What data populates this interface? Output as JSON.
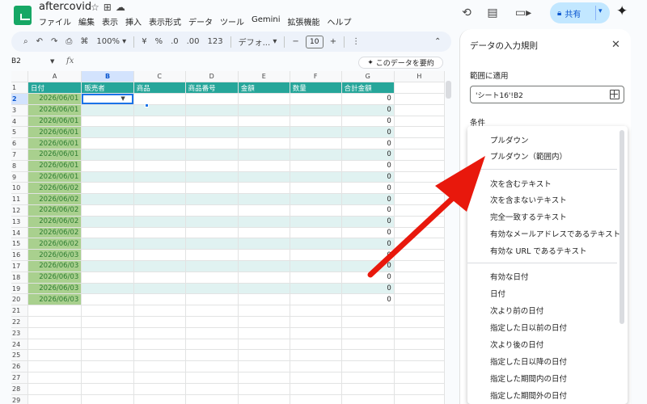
{
  "header": {
    "doc_title": "aftercovid",
    "title_icons": [
      "star-icon",
      "folder-move-icon",
      "cloud-saved-icon"
    ],
    "menu": [
      "ファイル",
      "編集",
      "表示",
      "挿入",
      "表示形式",
      "データ",
      "ツール",
      "Gemini",
      "拡張機能",
      "ヘルプ"
    ],
    "share_label": "共有",
    "right_icons": [
      "history-icon",
      "comment-icon",
      "meet-icon",
      "gemini-spark-icon"
    ]
  },
  "toolbar": {
    "zoom": "100%",
    "currency": "¥",
    "percent": "%",
    "dec_decrease": ".0",
    "dec_increase": ".00",
    "number_format": "123",
    "font": "デフォ...",
    "font_minus": "−",
    "font_size": "10",
    "font_plus": "+",
    "more": "⋮",
    "collapse": "⌃"
  },
  "formula_bar": {
    "name_box": "B2",
    "fx": "fx",
    "summarize_label": "このデータを要約"
  },
  "grid": {
    "col_letters": [
      "A",
      "B",
      "C",
      "D",
      "E",
      "F",
      "G",
      "H"
    ],
    "selected_col": "B",
    "header_row": [
      "日付",
      "販売者",
      "商品",
      "商品番号",
      "金額",
      "数量",
      "合計金額",
      ""
    ],
    "dates": [
      "2026/06/01",
      "2026/06/01",
      "2026/06/01",
      "2026/06/01",
      "2026/06/01",
      "2026/06/01",
      "2026/06/01",
      "2026/06/01",
      "2026/06/02",
      "2026/06/02",
      "2026/06/02",
      "2026/06/02",
      "2026/06/02",
      "2026/06/02",
      "2026/06/03",
      "2026/06/03",
      "2026/06/03",
      "2026/06/03",
      "2026/06/03"
    ],
    "totals": [
      "0",
      "0",
      "0",
      "0",
      "0",
      "0",
      "0",
      "0",
      "0",
      "0",
      "0",
      "0",
      "0",
      "0",
      "0",
      "0",
      "0",
      "0",
      "0"
    ],
    "row_numbers": [
      "1",
      "2",
      "3",
      "4",
      "5",
      "6",
      "7",
      "8",
      "9",
      "10",
      "11",
      "12",
      "13",
      "14",
      "15",
      "16",
      "17",
      "18",
      "19",
      "20",
      "21",
      "22",
      "23",
      "24",
      "25",
      "26",
      "27",
      "28",
      "29"
    ],
    "selected_row": "2"
  },
  "panel": {
    "title": "データの入力規則",
    "range_label": "範囲に適用",
    "range_value": "'シート16'!B2",
    "condition_label": "条件",
    "options_group1": [
      "プルダウン",
      "プルダウン（範囲内）"
    ],
    "options_group2": [
      "次を含むテキスト",
      "次を含まないテキスト",
      "完全一致するテキスト",
      "有効なメールアドレスであるテキスト",
      "有効な URL であるテキスト"
    ],
    "options_group3": [
      "有効な日付",
      "日付",
      "次より前の日付",
      "指定した日以前の日付",
      "次より後の日付",
      "指定した日以降の日付",
      "指定した期間内の日付",
      "指定した期間外の日付"
    ]
  },
  "annotation": {
    "arrow_color": "#e8180c"
  }
}
